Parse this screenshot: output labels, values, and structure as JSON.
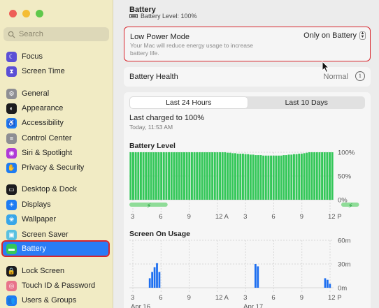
{
  "sidebar": {
    "search_placeholder": "Search",
    "items": [
      {
        "label": "Focus",
        "icon": "moon-icon",
        "color": "#5b4fd6"
      },
      {
        "label": "Screen Time",
        "icon": "hourglass-icon",
        "color": "#5b4fd6"
      },
      {
        "label": "General",
        "icon": "gear-icon",
        "color": "#8e8e93"
      },
      {
        "label": "Appearance",
        "icon": "appearance-icon",
        "color": "#1c1c1e"
      },
      {
        "label": "Accessibility",
        "icon": "accessibility-icon",
        "color": "#1e7cf2"
      },
      {
        "label": "Control Center",
        "icon": "control-center-icon",
        "color": "#8e8e93"
      },
      {
        "label": "Siri & Spotlight",
        "icon": "siri-icon",
        "color": "#b03ad8"
      },
      {
        "label": "Privacy & Security",
        "icon": "hand-icon",
        "color": "#1e7cf2"
      },
      {
        "label": "Desktop & Dock",
        "icon": "dock-icon",
        "color": "#1c1c1e"
      },
      {
        "label": "Displays",
        "icon": "sun-icon",
        "color": "#1e7cf2"
      },
      {
        "label": "Wallpaper",
        "icon": "wallpaper-icon",
        "color": "#39a6e8"
      },
      {
        "label": "Screen Saver",
        "icon": "screen-saver-icon",
        "color": "#59c0e0"
      },
      {
        "label": "Battery",
        "icon": "battery-icon",
        "color": "#34c759"
      },
      {
        "label": "Lock Screen",
        "icon": "lock-icon",
        "color": "#1c1c1e"
      },
      {
        "label": "Touch ID & Password",
        "icon": "fingerprint-icon",
        "color": "#e8738a"
      },
      {
        "label": "Users & Groups",
        "icon": "users-icon",
        "color": "#1e7cf2"
      }
    ],
    "selected": "Battery"
  },
  "main": {
    "title": "Battery",
    "battery_level_text": "Battery Level: 100%",
    "low_power": {
      "title": "Low Power Mode",
      "description": "Your Mac will reduce energy usage to increase battery life.",
      "value": "Only on Battery"
    },
    "health": {
      "label": "Battery Health",
      "value": "Normal"
    },
    "tabs": [
      "Last 24 Hours",
      "Last 10 Days"
    ],
    "active_tab": "Last 24 Hours",
    "last_charged": "Last charged to 100%",
    "charged_time": "Today, 11:53 AM"
  },
  "chart_data": [
    {
      "type": "bar",
      "title": "Battery Level",
      "color": "#34c759",
      "y_tick_labels": [
        "100%",
        "50%",
        "0%"
      ],
      "ylim": [
        0,
        100
      ],
      "x_tick_labels": [
        "3",
        "6",
        "9",
        "12 A",
        "3",
        "6",
        "9",
        "12 P"
      ],
      "values": [
        100,
        100,
        100,
        100,
        100,
        100,
        100,
        100,
        100,
        100,
        100,
        100,
        100,
        100,
        100,
        100,
        100,
        100,
        100,
        100,
        100,
        100,
        100,
        100,
        100,
        100,
        100,
        100,
        100,
        100,
        100,
        100,
        100,
        100,
        100,
        100,
        100,
        100,
        99,
        99,
        98,
        98,
        97,
        97,
        97,
        96,
        96,
        95,
        95,
        94,
        94,
        94,
        93,
        93,
        93,
        93,
        93,
        93,
        93,
        93,
        94,
        94,
        95,
        95,
        96,
        96,
        97,
        97,
        98,
        99,
        100,
        100,
        100,
        100,
        100,
        100,
        100,
        100,
        100,
        100
      ],
      "charging_segments": [
        {
          "start": 0,
          "end": 15
        },
        {
          "start": 83,
          "end": 90
        }
      ]
    },
    {
      "type": "bar",
      "title": "Screen On Usage",
      "color": "#1e6ff0",
      "y_tick_labels": [
        "60m",
        "30m",
        "0m"
      ],
      "ylim": [
        0,
        60
      ],
      "x_tick_labels": [
        "3",
        "6",
        "9",
        "12 A",
        "3",
        "6",
        "9",
        "12 P"
      ],
      "date_labels": [
        "Apr 16",
        "Apr 17"
      ],
      "values": [
        0,
        0,
        0,
        0,
        0,
        0,
        0,
        0,
        12,
        20,
        26,
        31,
        20,
        0,
        0,
        0,
        0,
        0,
        0,
        0,
        0,
        0,
        0,
        0,
        0,
        0,
        0,
        0,
        0,
        0,
        0,
        0,
        0,
        0,
        0,
        0,
        0,
        0,
        0,
        0,
        0,
        0,
        0,
        0,
        0,
        0,
        0,
        0,
        0,
        0,
        0,
        0,
        30,
        27,
        0,
        0,
        0,
        0,
        0,
        0,
        0,
        0,
        0,
        0,
        0,
        0,
        0,
        0,
        0,
        0,
        0,
        0,
        0,
        0,
        0,
        0,
        0,
        0,
        0,
        0,
        0,
        12,
        10,
        5,
        0
      ]
    }
  ]
}
